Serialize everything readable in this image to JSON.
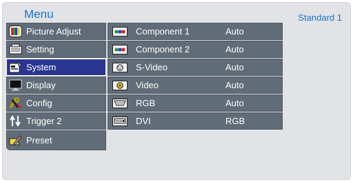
{
  "header": {
    "title": "Menu",
    "preset": "Standard 1"
  },
  "menu": {
    "items": [
      {
        "label": "Picture Adjust",
        "icon": "picture-adjust-icon"
      },
      {
        "label": "Setting",
        "icon": "setting-icon"
      },
      {
        "label": "System",
        "icon": "system-icon",
        "selected": true
      },
      {
        "label": "Display",
        "icon": "display-icon"
      },
      {
        "label": "Config",
        "icon": "config-icon"
      },
      {
        "label": "Trigger 2",
        "icon": "trigger-icon"
      },
      {
        "label": "Preset",
        "icon": "preset-icon"
      }
    ]
  },
  "inputs": {
    "rows": [
      {
        "name": "Component 1",
        "value": "Auto",
        "icon": "component-icon"
      },
      {
        "name": "Component 2",
        "value": "Auto",
        "icon": "component-icon"
      },
      {
        "name": "S-Video",
        "value": "Auto",
        "icon": "s-video-icon"
      },
      {
        "name": "Video",
        "value": "Auto",
        "icon": "video-icon"
      },
      {
        "name": "RGB",
        "value": "Auto",
        "icon": "rgb-icon"
      },
      {
        "name": "DVI",
        "value": "RGB",
        "icon": "dvi-icon"
      }
    ]
  },
  "colors": {
    "accent": "#1a73c8",
    "item_bg": "#606c78",
    "selected_bg": "#2a3691",
    "panel_bg": "#e1e3e6"
  }
}
